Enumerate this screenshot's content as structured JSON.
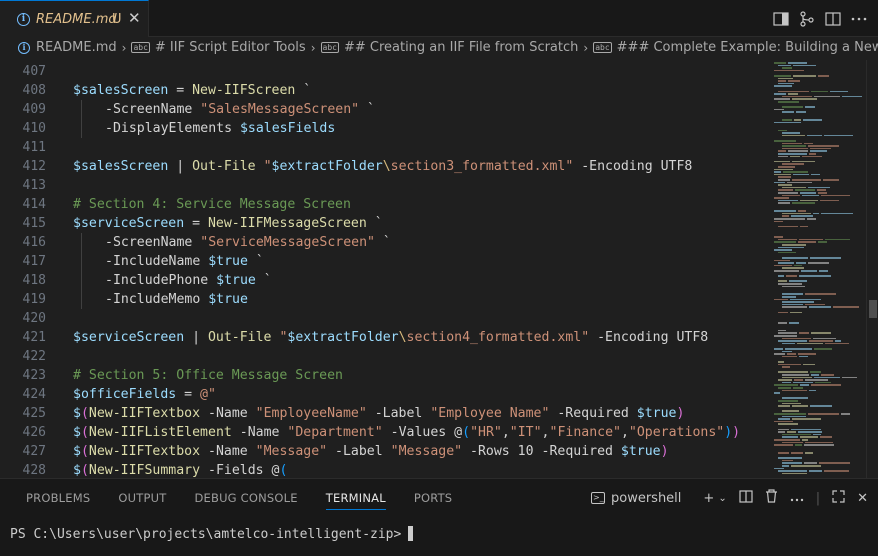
{
  "tab": {
    "label": "README.md",
    "status": "U",
    "close": "✕"
  },
  "breadcrumb": [
    {
      "icon": "info",
      "label": "README.md"
    },
    {
      "icon": "abc",
      "label": "# IIF Script Editor Tools"
    },
    {
      "icon": "abc",
      "label": "## Creating an IIF File from Scratch"
    },
    {
      "icon": "abc",
      "label": "### Complete Example: Building a New IIF File"
    },
    {
      "icon": "abc",
      "label": "###"
    }
  ],
  "editor": {
    "lines": [
      {
        "n": "407",
        "indent": 0,
        "tokens": []
      },
      {
        "n": "408",
        "indent": 0,
        "tokens": [
          [
            "var",
            "$salesScreen"
          ],
          [
            "op",
            " = "
          ],
          [
            "fn",
            "New-IIFScreen"
          ],
          [
            "plain",
            " `"
          ]
        ]
      },
      {
        "n": "409",
        "indent": 1,
        "tokens": [
          [
            "param",
            "-ScreenName "
          ],
          [
            "str",
            "\"SalesMessageScreen\""
          ],
          [
            "plain",
            " `"
          ]
        ]
      },
      {
        "n": "410",
        "indent": 1,
        "tokens": [
          [
            "param",
            "-DisplayElements "
          ],
          [
            "var",
            "$salesFields"
          ]
        ]
      },
      {
        "n": "411",
        "indent": 0,
        "tokens": []
      },
      {
        "n": "412",
        "indent": 0,
        "tokens": [
          [
            "var",
            "$salesScreen"
          ],
          [
            "op",
            " | "
          ],
          [
            "fn",
            "Out-File"
          ],
          [
            "plain",
            " "
          ],
          [
            "str",
            "\""
          ],
          [
            "var",
            "$extractFolder"
          ],
          [
            "esc",
            "\\"
          ],
          [
            "str",
            "section3_formatted.xml\""
          ],
          [
            "param",
            " -Encoding UTF8"
          ]
        ]
      },
      {
        "n": "413",
        "indent": 0,
        "tokens": []
      },
      {
        "n": "414",
        "indent": 0,
        "tokens": [
          [
            "cmt",
            "# Section 4: Service Message Screen"
          ]
        ]
      },
      {
        "n": "415",
        "indent": 0,
        "tokens": [
          [
            "var",
            "$serviceScreen"
          ],
          [
            "op",
            " = "
          ],
          [
            "fn",
            "New-IIFMessageScreen"
          ],
          [
            "plain",
            " `"
          ]
        ]
      },
      {
        "n": "416",
        "indent": 1,
        "tokens": [
          [
            "param",
            "-ScreenName "
          ],
          [
            "str",
            "\"ServiceMessageScreen\""
          ],
          [
            "plain",
            " `"
          ]
        ]
      },
      {
        "n": "417",
        "indent": 1,
        "tokens": [
          [
            "param",
            "-IncludeName "
          ],
          [
            "var",
            "$true"
          ],
          [
            "plain",
            " `"
          ]
        ]
      },
      {
        "n": "418",
        "indent": 1,
        "tokens": [
          [
            "param",
            "-IncludePhone "
          ],
          [
            "var",
            "$true"
          ],
          [
            "plain",
            " `"
          ]
        ]
      },
      {
        "n": "419",
        "indent": 1,
        "tokens": [
          [
            "param",
            "-IncludeMemo "
          ],
          [
            "var",
            "$true"
          ]
        ]
      },
      {
        "n": "420",
        "indent": 0,
        "tokens": []
      },
      {
        "n": "421",
        "indent": 0,
        "tokens": [
          [
            "var",
            "$serviceScreen"
          ],
          [
            "op",
            " | "
          ],
          [
            "fn",
            "Out-File"
          ],
          [
            "plain",
            " "
          ],
          [
            "str",
            "\""
          ],
          [
            "var",
            "$extractFolder"
          ],
          [
            "esc",
            "\\"
          ],
          [
            "str",
            "section4_formatted.xml\""
          ],
          [
            "param",
            " -Encoding UTF8"
          ]
        ]
      },
      {
        "n": "422",
        "indent": 0,
        "tokens": []
      },
      {
        "n": "423",
        "indent": 0,
        "tokens": [
          [
            "cmt",
            "# Section 5: Office Message Screen"
          ]
        ]
      },
      {
        "n": "424",
        "indent": 0,
        "tokens": [
          [
            "var",
            "$officeFields"
          ],
          [
            "op",
            " = "
          ],
          [
            "str",
            "@\""
          ]
        ]
      },
      {
        "n": "425",
        "indent": 0,
        "tokens": [
          [
            "var",
            "$"
          ],
          [
            "brace",
            "("
          ],
          [
            "fn",
            "New-IIFTextbox"
          ],
          [
            "param",
            " -Name "
          ],
          [
            "str",
            "\"EmployeeName\""
          ],
          [
            "param",
            " -Label "
          ],
          [
            "str",
            "\"Employee Name\""
          ],
          [
            "param",
            " -Required "
          ],
          [
            "var",
            "$true"
          ],
          [
            "brace",
            ")"
          ]
        ]
      },
      {
        "n": "426",
        "indent": 0,
        "tokens": [
          [
            "var",
            "$"
          ],
          [
            "brace",
            "("
          ],
          [
            "fn",
            "New-IIFListElement"
          ],
          [
            "param",
            " -Name "
          ],
          [
            "str",
            "\"Department\""
          ],
          [
            "param",
            " -Values "
          ],
          [
            "op",
            "@"
          ],
          [
            "brace2",
            "("
          ],
          [
            "str",
            "\"HR\""
          ],
          [
            "op",
            ","
          ],
          [
            "str",
            "\"IT\""
          ],
          [
            "op",
            ","
          ],
          [
            "str",
            "\"Finance\""
          ],
          [
            "op",
            ","
          ],
          [
            "str",
            "\"Operations\""
          ],
          [
            "brace2",
            ")"
          ],
          [
            "brace",
            ")"
          ]
        ]
      },
      {
        "n": "427",
        "indent": 0,
        "tokens": [
          [
            "var",
            "$"
          ],
          [
            "brace",
            "("
          ],
          [
            "fn",
            "New-IIFTextbox"
          ],
          [
            "param",
            " -Name "
          ],
          [
            "str",
            "\"Message\""
          ],
          [
            "param",
            " -Label "
          ],
          [
            "str",
            "\"Message\""
          ],
          [
            "param",
            " -Rows 10 -Required "
          ],
          [
            "var",
            "$true"
          ],
          [
            "brace",
            ")"
          ]
        ]
      },
      {
        "n": "428",
        "indent": 0,
        "tokens": [
          [
            "var",
            "$"
          ],
          [
            "brace",
            "("
          ],
          [
            "fn",
            "New-IIFSummary"
          ],
          [
            "param",
            " -Fields "
          ],
          [
            "op",
            "@"
          ],
          [
            "brace2",
            "("
          ]
        ]
      }
    ]
  },
  "panel": {
    "tabs": [
      "PROBLEMS",
      "OUTPUT",
      "DEBUG CONSOLE",
      "TERMINAL",
      "PORTS"
    ],
    "active_tab": "TERMINAL",
    "shell": "powershell",
    "prompt": "PS C:\\Users\\user\\projects\\amtelco-intelligent-zip>"
  },
  "colors": {
    "accent": "#0078d4",
    "modified": "#e2c08d",
    "background": "#1f1f1f"
  }
}
